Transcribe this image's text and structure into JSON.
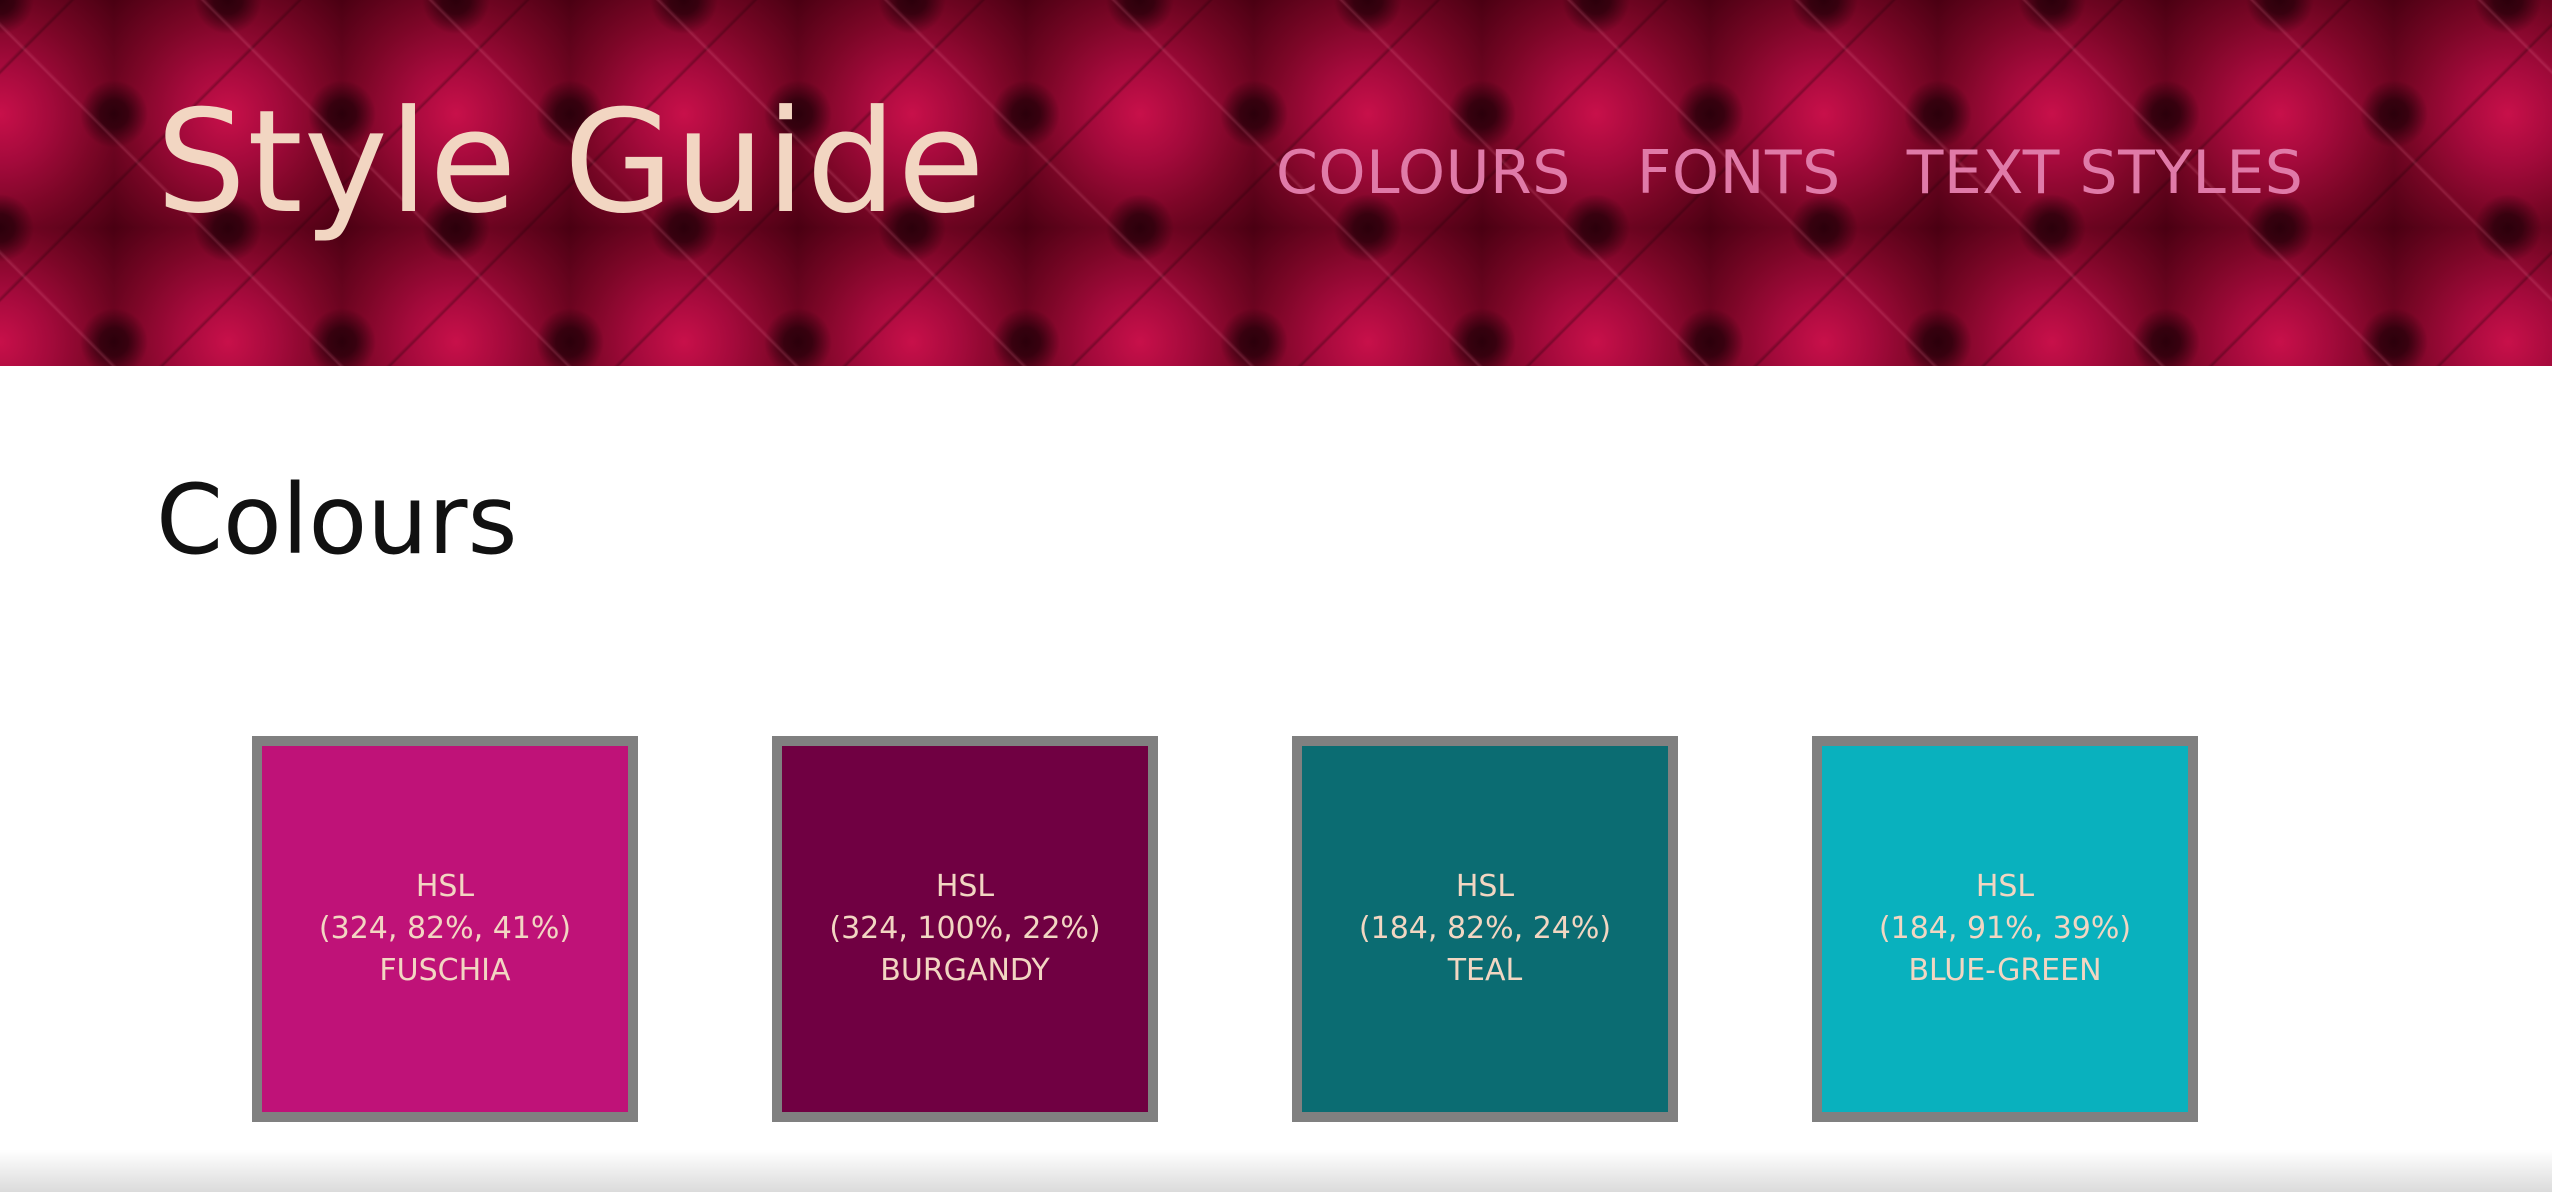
{
  "header": {
    "title": "Style Guide",
    "nav": [
      "COLOURS",
      "FONTS",
      "TEXT STYLES"
    ]
  },
  "colours": {
    "heading": "Colours",
    "swatches": [
      {
        "model": "HSL",
        "values": "(324, 82%, 41%)",
        "name": "FUSCHIA",
        "color": "#bf1278"
      },
      {
        "model": "HSL",
        "values": "(324, 100%, 22%)",
        "name": "BURGANDY",
        "color": "#700042"
      },
      {
        "model": "HSL",
        "values": "(184, 82%, 24%)",
        "name": "TEAL",
        "color": "#0b6c72"
      },
      {
        "model": "HSL",
        "values": "(184, 91%, 39%)",
        "name": "BLUE-GREEN",
        "color": "#09b1be"
      }
    ],
    "text_color": "#f2d6c2",
    "border_color": "#808080"
  },
  "theme": {
    "title_color": "#f2d6c2",
    "nav_color": "#e07aa8",
    "header_bg": "#8a0a30"
  }
}
